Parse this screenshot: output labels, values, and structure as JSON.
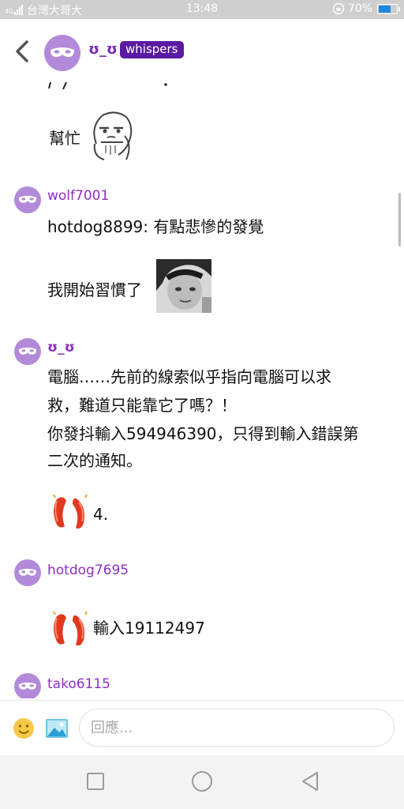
{
  "status_bar": {
    "carrier": "台灣大哥大",
    "time": "13:48",
    "battery": "70%",
    "battery_level": 0.7
  },
  "header": {
    "title": "ʊ_ʊ",
    "badge": "whispers"
  },
  "messages": [
    {
      "sender": "",
      "text": "幫忙"
    },
    {
      "sender": "wolf7001",
      "lines": [
        "hotdog8899: 有點悲慘的發覺",
        "我開始習慣了"
      ]
    },
    {
      "sender": "ʊ_ʊ",
      "lines": [
        "電腦……先前的線索似乎指向電腦可以求",
        "救，難道只能靠它了嗎？！",
        "你發抖輸入594946390，只得到輸入錯誤第",
        "二次的通知。"
      ],
      "sticker_caption": "4."
    },
    {
      "sender": "hotdog7695",
      "sticker_caption": "輸入19112497"
    },
    {
      "sender": "tako6115"
    }
  ],
  "composer": {
    "placeholder": "回應..."
  },
  "colors": {
    "accent": "#8e2fc7",
    "avatar": "#b28ad9",
    "badge_bg": "#5b1aa3"
  },
  "icons": [
    "back-icon",
    "mask-icon",
    "emoji-icon",
    "image-icon",
    "square-icon",
    "circle-icon",
    "triangle-back-icon"
  ]
}
